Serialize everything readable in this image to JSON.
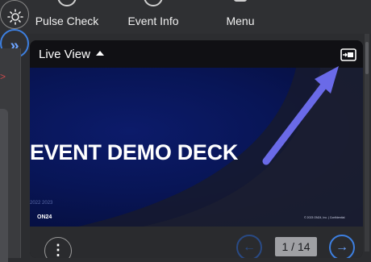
{
  "topbar": {
    "nav": [
      {
        "label": "Pulse Check",
        "icon": "pulse-check-icon"
      },
      {
        "label": "Event Info",
        "icon": "info-icon"
      },
      {
        "label": "Menu",
        "icon": "menu-icon"
      }
    ],
    "settings_icon": "sun-icon",
    "expand_icon": "double-chevron-right-icon",
    "expand_glyph": "»"
  },
  "card": {
    "title": "Live View",
    "popout_icon": "popout-icon",
    "slide": {
      "title": "EVENT DEMO DECK",
      "year": "2022 2023",
      "logo": "ON24",
      "copyright": "© 2023 ON24, Inc. | Confidential"
    },
    "footer": {
      "more_glyph": "⋮",
      "prev_glyph": "←",
      "page": "1 / 14",
      "next_glyph": "→"
    }
  },
  "annotation": {
    "color": "#6a6ae8",
    "icon": "arrow-annotation"
  },
  "colors": {
    "accent": "#3d7fe0",
    "background": "#2c2d30",
    "slide": "#081556"
  }
}
